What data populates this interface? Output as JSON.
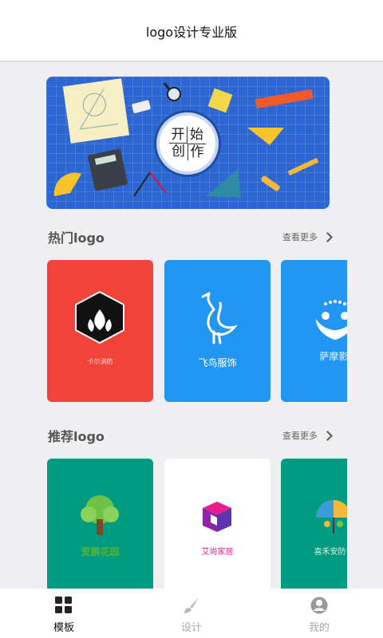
{
  "header": {
    "title": "logo设计专业版"
  },
  "banner": {
    "chars": [
      "开",
      "始",
      "创",
      "作"
    ]
  },
  "hot": {
    "title": "热门logo",
    "more": "查看更多",
    "cards": [
      {
        "name": "卡尔消防",
        "bg": "#f1433a"
      },
      {
        "name": "飞鸟服饰",
        "bg": "#2196f3"
      },
      {
        "name": "萨摩影",
        "bg": "#2196f3"
      }
    ]
  },
  "recommend": {
    "title": "推荐logo",
    "more": "查看更多",
    "cards": [
      {
        "name": "爱鹏花园",
        "bg": "#009b81"
      },
      {
        "name": "艾尚家居",
        "bg": "#ffffff"
      },
      {
        "name": "喜禾安防设",
        "bg": "#009b81"
      }
    ]
  },
  "tabs": [
    {
      "label": "模板",
      "icon": "grid-icon",
      "active": true
    },
    {
      "label": "设计",
      "icon": "brush-icon",
      "active": false
    },
    {
      "label": "我的",
      "icon": "person-icon",
      "active": false
    }
  ],
  "colors": {
    "accent": "#2196f3",
    "red": "#f1433a",
    "teal": "#009b81"
  }
}
